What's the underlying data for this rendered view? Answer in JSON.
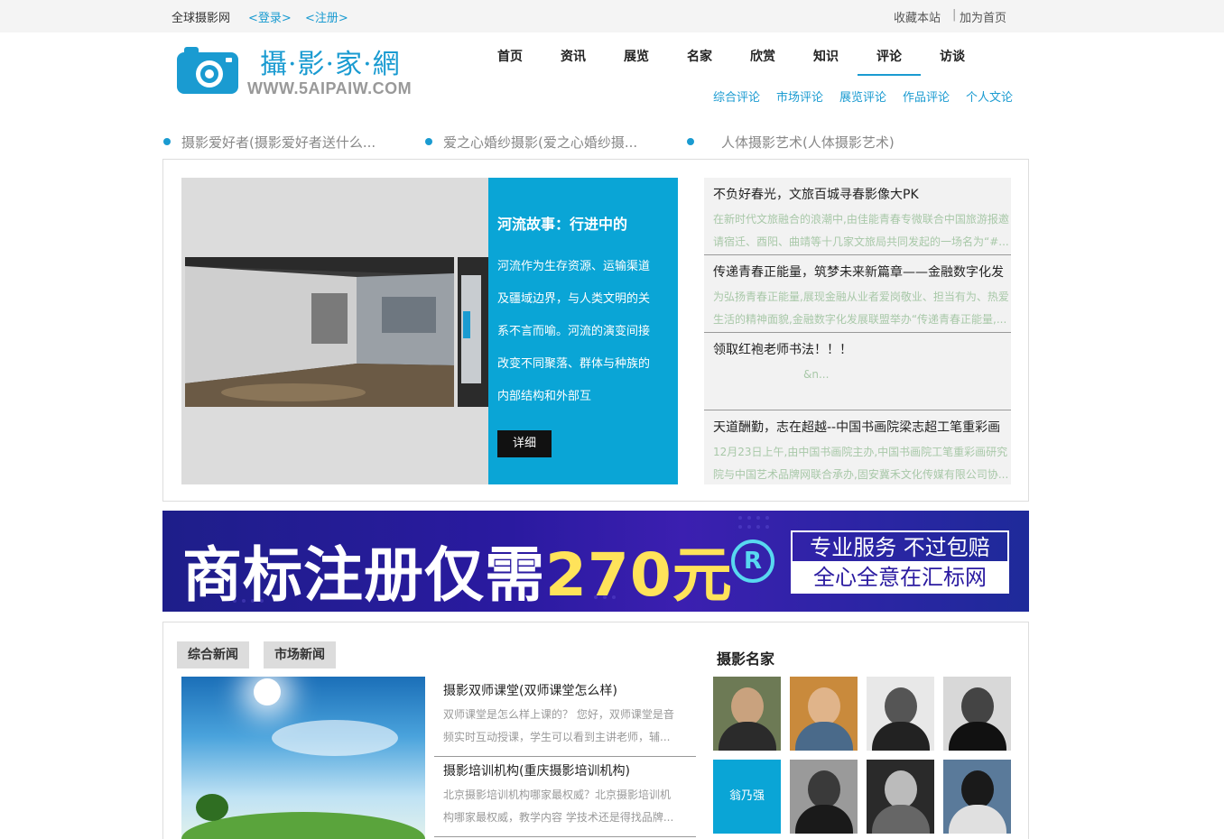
{
  "topbar": {
    "site_name": "全球摄影网",
    "login": "<登录>",
    "register": "<注册>",
    "favorite": "收藏本站",
    "separator": "|",
    "set_home": "加为首页"
  },
  "logo": {
    "title": "攝·影·家·網",
    "url": "WWW.5AIPAIW.COM",
    "icon": "camera-icon"
  },
  "nav": {
    "items": [
      "首页",
      "资讯",
      "展览",
      "名家",
      "欣赏",
      "知识",
      "评论",
      "访谈"
    ],
    "active": "评论",
    "sub_items": [
      "综合评论",
      "市场评论",
      "展览评论",
      "作品评论",
      "个人文论"
    ]
  },
  "ticker": [
    "摄影爱好者(摄影爱好者送什么...",
    "爱之心婚纱摄影(爱之心婚纱摄...",
    "人体摄影艺术(人体摄影艺术)"
  ],
  "featured": {
    "title": "河流故事：行进中的",
    "desc": "河流作为生存资源、运输渠道及疆域边界，与人类文明的关系不言而喻。河流的演变间接改变不同聚落、群体与种族的内部结构和外部互",
    "button": "详细"
  },
  "news": [
    {
      "title": "不负好春光，文旅百城寻春影像大PK",
      "desc": "在新时代文旅融合的浪潮中,由佳能青春专微联合中国旅游报邀请宿迁、酉阳、曲靖等十几家文旅局共同发起的一场名为“#..."
    },
    {
      "title": "传递青春正能量，筑梦未来新篇章——金融数字化发",
      "desc": "为弘扬青春正能量,展现金融从业者爱岗敬业、担当有为、热爱生活的精神面貌,金融数字化发展联盟举办“传递青春正能量,..."
    },
    {
      "title": "领取红袍老师书法！！！",
      "desc": "&n..."
    },
    {
      "title": "天道酬勤，志在超越--中国书画院梁志超工笔重彩画",
      "desc": "12月23日上午,由中国书画院主办,中国书画院工笔重彩画研究院与中国艺术品牌网联合承办,固安冀禾文化传媒有限公司协..."
    }
  ],
  "banner": {
    "main_text": "商标注册仅需",
    "price": "270元",
    "registered_mark": "R",
    "line1": "专业服务 不过包赔",
    "line2": "全心全意在汇标网"
  },
  "bottom": {
    "tabs": [
      "综合新闻",
      "市场新闻"
    ],
    "news": [
      {
        "title": "摄影双师课堂(双师课堂怎么样)",
        "desc": "双师课堂是怎么样上课的？ 您好，双师课堂是音频实时互动授课，学生可以看到主讲老师，辅..."
      },
      {
        "title": "摄影培训机构(重庆摄影培训机构)",
        "desc": "北京摄影培训机构哪家最权威？北京摄影培训机构哪家最权威，教学内容 学技术还是得找品牌..."
      }
    ],
    "famous_title": "摄影名家",
    "famous_name": "翁乃强"
  },
  "colors": {
    "accent": "#1a9bd1",
    "panel": "#0aa5d6"
  }
}
